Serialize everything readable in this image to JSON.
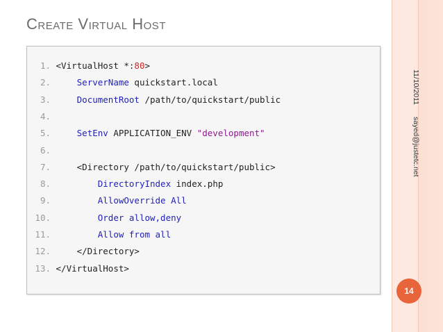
{
  "slide": {
    "title": "Create Virtual Host",
    "date": "11/10/2011",
    "author_email": "sayed@justetc.net",
    "page_number": "14"
  },
  "code": {
    "lines": [
      {
        "n": "1.",
        "parts": [
          {
            "t": "<VirtualHost *:"
          },
          {
            "t": "80",
            "c": "num"
          },
          {
            "t": ">"
          }
        ]
      },
      {
        "n": "2.",
        "parts": [
          {
            "t": "    "
          },
          {
            "t": "ServerName",
            "c": "kw"
          },
          {
            "t": " quickstart.local"
          }
        ]
      },
      {
        "n": "3.",
        "parts": [
          {
            "t": "    "
          },
          {
            "t": "DocumentRoot",
            "c": "kw"
          },
          {
            "t": " /path/to/quickstart/public"
          }
        ]
      },
      {
        "n": "4.",
        "parts": []
      },
      {
        "n": "5.",
        "parts": [
          {
            "t": "    "
          },
          {
            "t": "SetEnv",
            "c": "kw"
          },
          {
            "t": " APPLICATION_ENV "
          },
          {
            "t": "\"development\"",
            "c": "str"
          }
        ]
      },
      {
        "n": "6.",
        "parts": []
      },
      {
        "n": "7.",
        "parts": [
          {
            "t": "    <Directory /path/to/quickstart/public>"
          }
        ]
      },
      {
        "n": "8.",
        "parts": [
          {
            "t": "        "
          },
          {
            "t": "DirectoryIndex",
            "c": "kw"
          },
          {
            "t": " index.php"
          }
        ]
      },
      {
        "n": "9.",
        "parts": [
          {
            "t": "        "
          },
          {
            "t": "AllowOverride All",
            "c": "kw"
          }
        ]
      },
      {
        "n": "10.",
        "parts": [
          {
            "t": "        "
          },
          {
            "t": "Order allow,deny",
            "c": "kw"
          }
        ]
      },
      {
        "n": "11.",
        "parts": [
          {
            "t": "        "
          },
          {
            "t": "Allow from all",
            "c": "kw"
          }
        ]
      },
      {
        "n": "12.",
        "parts": [
          {
            "t": "    </Directory>"
          }
        ]
      },
      {
        "n": "13.",
        "parts": [
          {
            "t": "</VirtualHost>"
          }
        ]
      }
    ]
  },
  "colors": {
    "accent": "#e8643a",
    "keyword": "#1f1fb8",
    "string": "#8b1a8b",
    "number": "#c62828",
    "line_number": "#9a9a9a"
  }
}
